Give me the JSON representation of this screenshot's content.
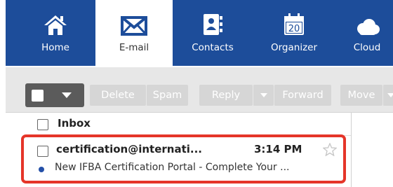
{
  "nav": {
    "home": "Home",
    "email": "E-mail",
    "contacts": "Contacts",
    "organizer": "Organizer",
    "organizer_day": "20",
    "cloud": "Cloud"
  },
  "toolbar": {
    "delete": "Delete",
    "spam": "Spam",
    "reply": "Reply",
    "forward": "Forward",
    "move": "Move"
  },
  "folder": {
    "name": "Inbox"
  },
  "mail": {
    "from": "certification@internati...",
    "time": "3:14 PM",
    "subject": "New IFBA Certification Portal - Complete Your ..."
  },
  "colors": {
    "nav_bg": "#1d4d9a",
    "highlight": "#e53529",
    "unread_dot": "#2450a8",
    "toolbar_bg": "#e7e7e7"
  },
  "icons": [
    "home-icon",
    "envelope-icon",
    "contacts-icon",
    "calendar-icon",
    "cloud-icon",
    "star-icon"
  ]
}
